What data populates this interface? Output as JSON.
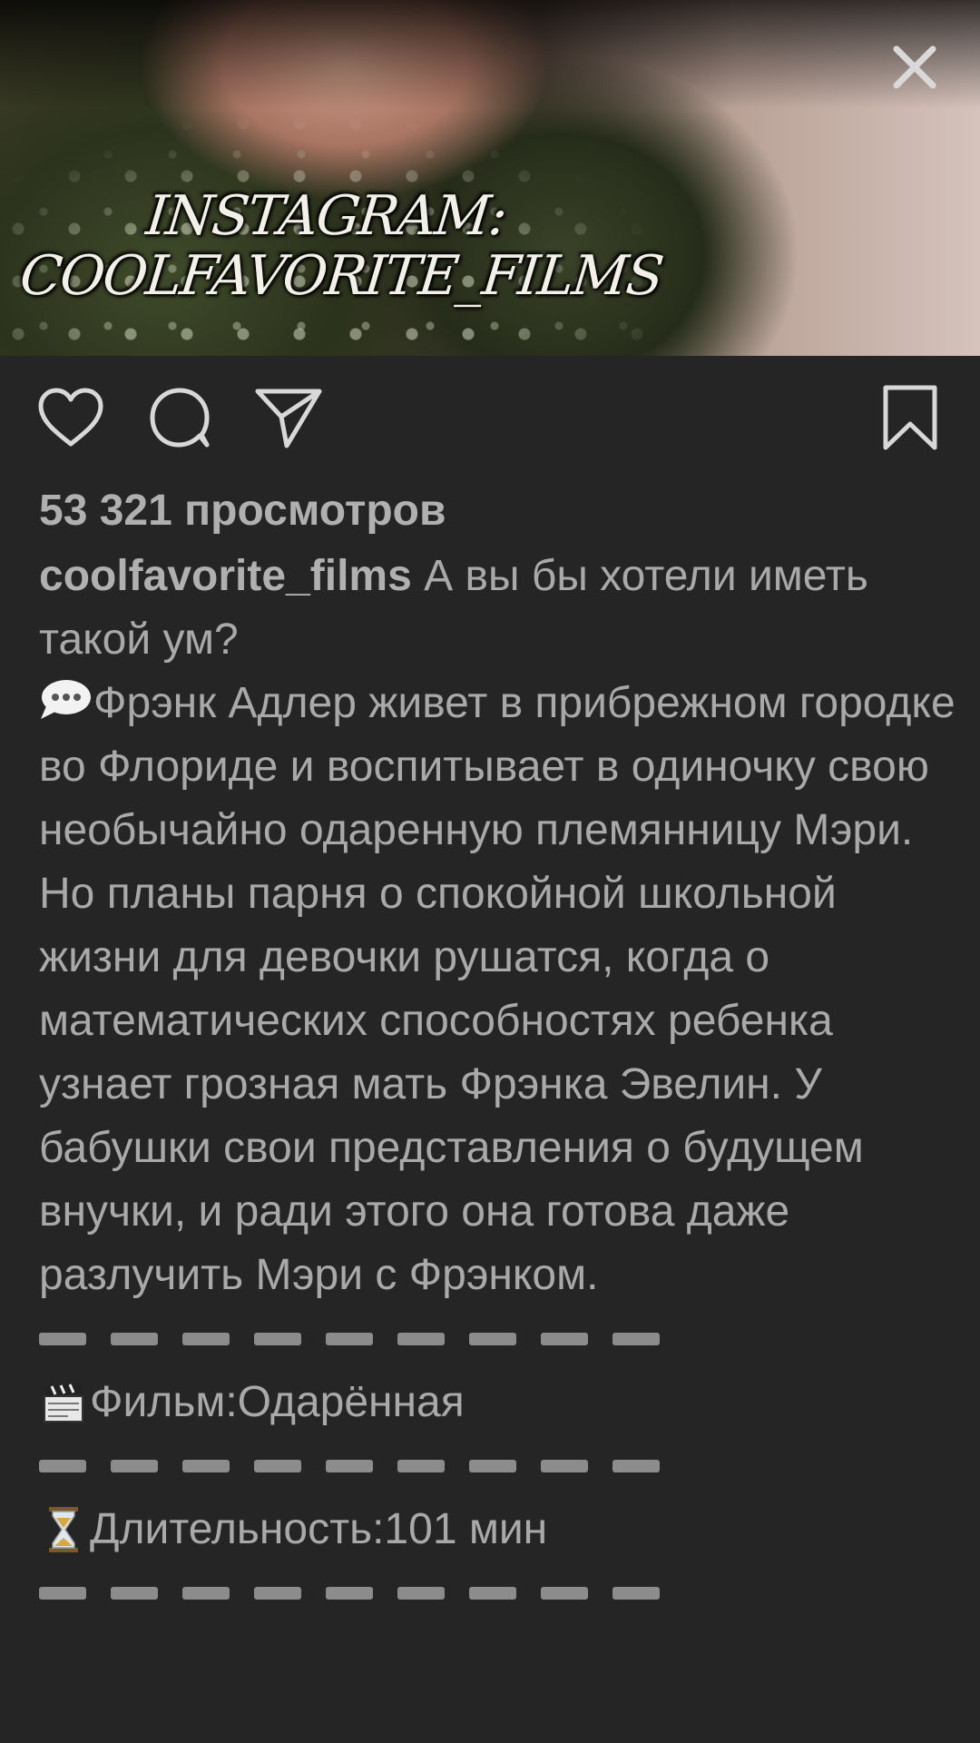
{
  "video": {
    "watermark_line1": "INSTAGRAM:",
    "watermark_line2": "COOLFAVORITE_FILMS"
  },
  "actions": {
    "like_icon": "heart-outline-icon",
    "comment_icon": "comment-bubble-icon",
    "share_icon": "paper-plane-icon",
    "save_icon": "bookmark-icon",
    "close_icon": "close-x-icon"
  },
  "post": {
    "views": "53 321 просмотров",
    "username": "coolfavorite_films",
    "caption_intro": "А вы бы хотели иметь такой ум?",
    "description_icon": "speech-bubble-emoji",
    "description": "Фрэнк Адлер живет в прибрежном городке во Флориде и воспитывает в одиночку свою необычайно одаренную племянницу Мэри. Но планы парня о спокойной школьной жизни для девочки рушатся, когда о математических способностях ребенка узнает грозная мать Фрэнка Эвелин. У бабушки свои представления о будущем внучки, и ради этого она готова даже разлучить Мэри с Фрэнком.",
    "film_icon": "clapperboard-emoji",
    "film_text": "Фильм:Одарённая",
    "duration_icon": "hourglass-emoji",
    "duration_text": "Длительность:101 мин"
  },
  "colors": {
    "background": "#252525",
    "text": "#a9a9a9",
    "icon": "#d8d8d8",
    "divider": "#8c8c8c"
  }
}
